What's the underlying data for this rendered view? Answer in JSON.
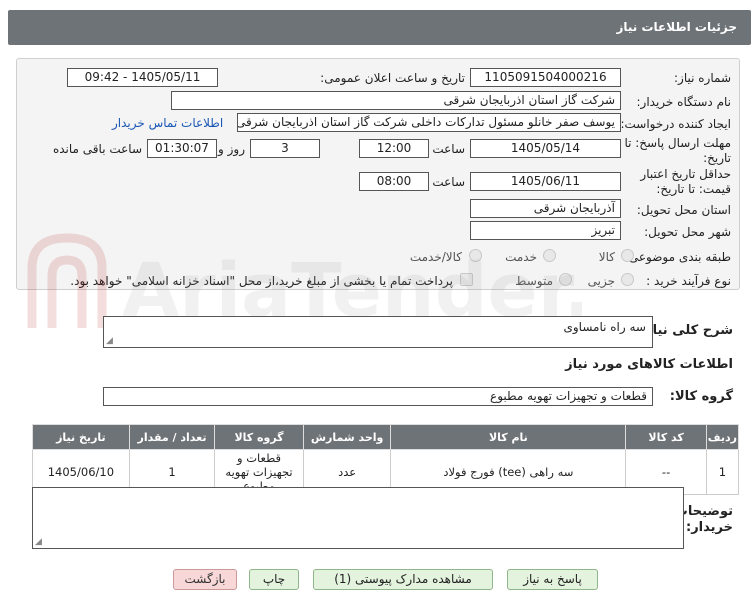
{
  "header": {
    "title": "جزئیات اطلاعات نیاز"
  },
  "form": {
    "need_number_label": "شماره نیاز:",
    "need_number": "1105091504000216",
    "announce_label": "تاریخ و ساعت اعلان عمومی:",
    "announce_value": "1405/05/11 - 09:42",
    "buyer_org_label": "نام دستگاه خریدار:",
    "buyer_org": "شرکت گاز استان اذربایجان شرقی",
    "creator_label": "ایجاد کننده درخواست:",
    "creator": "یوسف صفر خانلو  مسئول تدارکات داخلی  شرکت گاز استان اذربایجان شرقی",
    "contact_link": "اطلاعات تماس خریدار",
    "reply_deadline_label_1": "مهلت ارسال پاسخ: تا",
    "reply_deadline_label_2": "تاریخ:",
    "reply_date": "1405/05/14",
    "time_label": "ساعت",
    "reply_time": "12:00",
    "days_value": "3",
    "days_label": "روز و",
    "remaining_time": "01:30:07",
    "remaining_label": "ساعت باقی مانده",
    "validity_label_1": "حداقل تاریخ اعتبار",
    "validity_label_2": "قیمت: تا تاریخ:",
    "validity_date": "1405/06/11",
    "validity_time_label": "ساعت",
    "validity_time": "08:00",
    "province_label": "استان محل تحویل:",
    "province": "آذربایجان شرقی",
    "city_label": "شهر محل تحویل:",
    "city": "تبریز",
    "category_label": "طبقه بندی موضوعی:",
    "category_options": [
      "کالا",
      "خدمت",
      "کالا/خدمت"
    ],
    "process_label": "نوع فرآیند خرید :",
    "process_options": [
      "جزیی",
      "متوسط"
    ],
    "payment_note": "پرداخت تمام یا بخشی از مبلغ خرید،از محل \"اسناد خزانه اسلامی\" خواهد بود."
  },
  "description": {
    "label": "شرح کلی نیاز:",
    "value": "سه راه نامساوی"
  },
  "goods_section": {
    "title": "اطلاعات کالاهای مورد نیاز",
    "group_label": "گروه کالا:",
    "group_value": "قطعات و تجهیزات تهویه مطبوع"
  },
  "table": {
    "headers": [
      "ردیف",
      "کد کالا",
      "نام کالا",
      "واحد شمارش",
      "گروه کالا",
      "تعداد / مقدار",
      "تاریخ نیاز"
    ],
    "rows": [
      [
        "1",
        "--",
        "سه راهی (tee) فورج فولاد",
        "عدد",
        "قطعات و تجهیزات تهویه مطبوع",
        "1",
        "1405/06/10"
      ]
    ]
  },
  "buyer_notes": {
    "label_1": "توضیحات",
    "label_2": "خریدار:",
    "value": ""
  },
  "buttons": {
    "reply": "پاسخ به نیاز",
    "attachments": "مشاهده مدارک پیوستی (1)",
    "print": "چاپ",
    "back": "بازگشت"
  },
  "watermark_text": "AriaTender.neT",
  "colors": {
    "header_bg": "#6e7377",
    "button_bg": "#e3f3dd",
    "back_bg": "#f7d7d7",
    "link": "#1a57b5"
  }
}
